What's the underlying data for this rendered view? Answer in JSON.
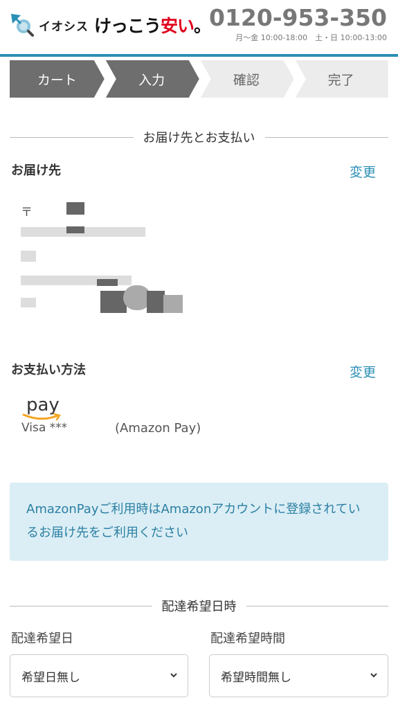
{
  "header": {
    "brand_small": "イオシス",
    "brand_main": "けっこう",
    "brand_red": "安い",
    "brand_dot": "。",
    "phone": "0120-953-350",
    "hours": "月〜金 10:00-18:00　土・日 10:00-13:00"
  },
  "steps": [
    {
      "label": "カート",
      "state": "active"
    },
    {
      "label": "入力",
      "state": "active"
    },
    {
      "label": "確認",
      "state": "inactive"
    },
    {
      "label": "完了",
      "state": "inactive"
    }
  ],
  "delivery_payment": {
    "section_title": "お届け先とお支払い",
    "address_label": "お届け先",
    "address_change": "変更",
    "postal_mark": "〒",
    "payment_label": "お支払い方法",
    "payment_change": "変更",
    "pay_logo_text": "pay",
    "card_text": "Visa ***",
    "method_text": "(Amazon Pay)"
  },
  "notice": {
    "text": "AmazonPayご利用時はAmazonアカウントに登録されているお届け先をご利用ください"
  },
  "delivery_time": {
    "section_title": "配達希望日時",
    "date_label": "配達希望日",
    "date_value": "希望日無し",
    "time_label": "配達希望時間",
    "time_value": "希望時間無し"
  },
  "colors": {
    "accent": "#2b8fb5",
    "step_active": "#6e6e6e",
    "step_inactive": "#ececec",
    "brand_red": "#e0001b",
    "notice_bg": "#dbeef5"
  }
}
